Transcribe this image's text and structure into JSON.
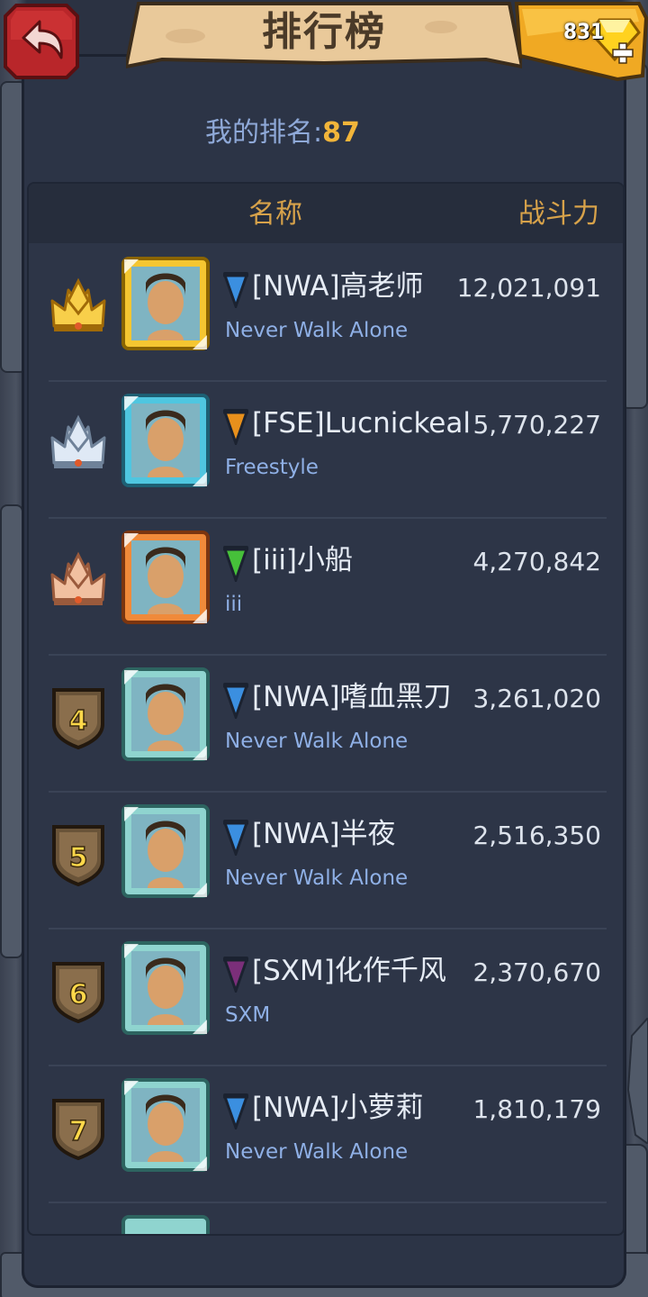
{
  "header": {
    "title": "排行榜",
    "gems": "831"
  },
  "my_rank": {
    "label": "我的排名:",
    "value": "87"
  },
  "columns": {
    "name": "名称",
    "power": "战斗力"
  },
  "rows": [
    {
      "rank": "1",
      "badge": "gold-crown",
      "flag_color": "#3b8fe0",
      "name": "[NWA]高老师",
      "clan": "Never Walk Alone",
      "power": "12,021,091",
      "frame": "gold"
    },
    {
      "rank": "2",
      "badge": "silver-crown",
      "flag_color": "#e8901c",
      "name": "[FSE]Lucnickeal",
      "clan": "Freestyle",
      "power": "5,770,227",
      "frame": "cyan"
    },
    {
      "rank": "3",
      "badge": "bronze-crown",
      "flag_color": "#46c03a",
      "name": "[iii]小船",
      "clan": "iii",
      "power": "4,270,842",
      "frame": "orange"
    },
    {
      "rank": "4",
      "badge": "shield",
      "flag_color": "#3b8fe0",
      "name": "[NWA]嗜血黑刀",
      "clan": "Never Walk Alone",
      "power": "3,261,020",
      "frame": "teal"
    },
    {
      "rank": "5",
      "badge": "shield",
      "flag_color": "#3b8fe0",
      "name": "[NWA]半夜",
      "clan": "Never Walk Alone",
      "power": "2,516,350",
      "frame": "teal"
    },
    {
      "rank": "6",
      "badge": "shield",
      "flag_color": "#7b2f7a",
      "name": "[SXM]化作千风",
      "clan": "SXM",
      "power": "2,370,670",
      "frame": "teal"
    },
    {
      "rank": "7",
      "badge": "shield",
      "flag_color": "#3b8fe0",
      "name": "[NWA]小萝莉",
      "clan": "Never Walk Alone",
      "power": "1,810,179",
      "frame": "teal"
    }
  ]
}
